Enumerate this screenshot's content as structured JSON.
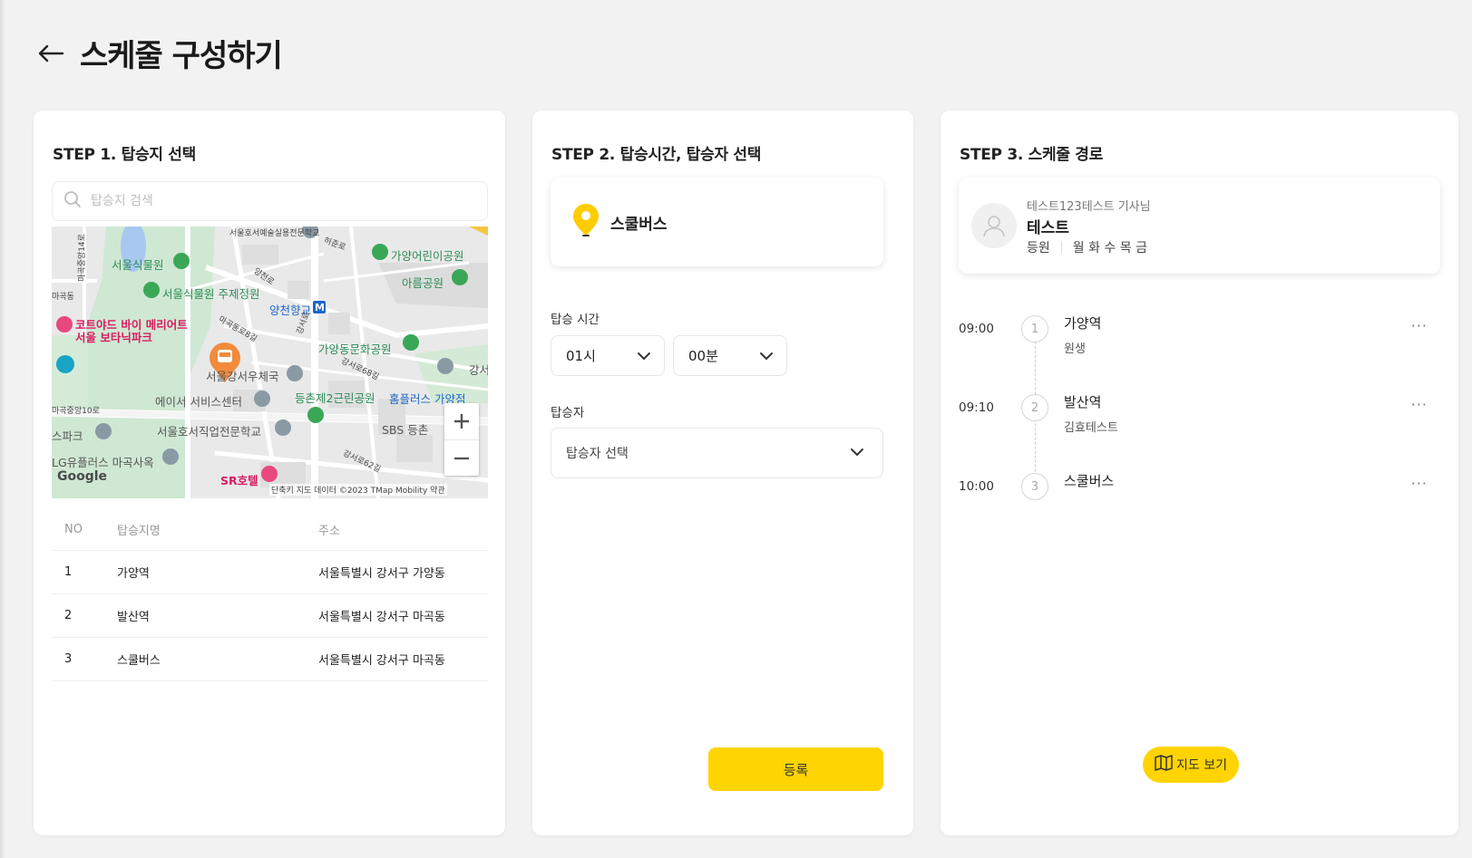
{
  "page": {
    "title": "스케줄 구성하기"
  },
  "step1": {
    "title": "STEP 1. 탑승지 선택",
    "search_placeholder": "탑승지 검색",
    "map": {
      "labels": {
        "botanic_garden": "서울식물원",
        "theme_garden": "서울식물원 주제정원",
        "courtyard1": "코트야드 바이 메리어트",
        "courtyard2": "서울 보타닉파크",
        "yangcheon": "양천향교",
        "gayang_kids": "가양어린이공원",
        "areum": "아름공원",
        "gayang_culture": "가양동문화공원",
        "post": "서울강서우체국",
        "service": "에이서 서비스센터",
        "deungchon": "등촌제2근린공원",
        "homeplus": "홈플러스 가양점",
        "hoseo": "서울호서직업전문학교",
        "sbs": "SBS 등촌",
        "sr_hotel": "SR호텔",
        "lg": "LG유플러스 마곡사옥",
        "park_left": "스파크",
        "top_school": "서울호서예술실용전문학교",
        "heojunro": "허준로",
        "yangcheonro": "양천로",
        "magokdong8": "마곡동로8길",
        "gangseoro": "강서로",
        "gangseoro68": "강서로68길",
        "gangseoro62": "강서로62길",
        "magokjungang10": "마곡중앙10로",
        "magokjungang14": "마곡중앙14로",
        "magok": "마곡동",
        "gang": "강서",
        "google": "Google",
        "attribution": "단축키  지도 데이터 ©2023 TMap Mobility  약관"
      }
    },
    "table": {
      "headers": [
        "NO",
        "탑승지명",
        "주소"
      ],
      "rows": [
        {
          "no": "1",
          "name": "가양역",
          "address": "서울특별시 강서구 가양동"
        },
        {
          "no": "2",
          "name": "발산역",
          "address": "서울특별시 강서구 마곡동"
        },
        {
          "no": "3",
          "name": "스쿨버스",
          "address": "서울특별시 강서구 마곡동"
        }
      ]
    }
  },
  "step2": {
    "title": "STEP 2. 탑승시간, 탑승자 선택",
    "selected_stop": "스쿨버스",
    "time_label": "탑승 시간",
    "hour": "01시",
    "minute": "00분",
    "rider_label": "탑승자",
    "rider_placeholder": "탑승자 선택",
    "register_button": "등록"
  },
  "step3": {
    "title": "STEP 3. 스케줄 경로",
    "driver": {
      "subtitle": "테스트123테스트 기사님",
      "name": "테스트",
      "type": "등원",
      "days": "월 화 수 목 금"
    },
    "stops": [
      {
        "time": "09:00",
        "num": "1",
        "name": "가양역",
        "rider": "원생"
      },
      {
        "time": "09:10",
        "num": "2",
        "name": "발산역",
        "rider": "김효테스트"
      },
      {
        "time": "10:00",
        "num": "3",
        "name": "스쿨버스",
        "rider": ""
      }
    ],
    "more": "···",
    "map_button": "지도 보기"
  },
  "colors": {
    "accent": "#ffd400",
    "background": "#f2f2f2",
    "map_green": "#cfe8d3",
    "map_orange": "#f28b3c"
  }
}
